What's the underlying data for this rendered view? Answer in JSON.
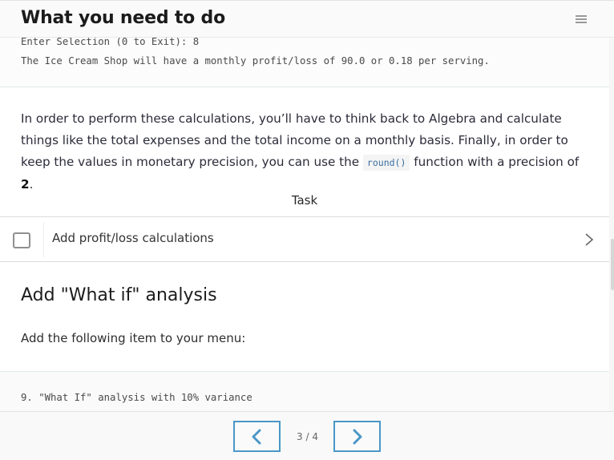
{
  "header": {
    "title": "What you need to do",
    "menu_icon": "hamburger-menu-icon"
  },
  "code_output": {
    "lines": [
      "Enter Selection (0 to Exit): 8",
      "The Ice Cream Shop will have a monthly profit/loss of 90.0 or 0.18 per serving."
    ]
  },
  "instructions": {
    "text_before_code": "In order to perform these calculations, you’ll have to think back to Algebra and calculate things like the total expenses and the total income on a monthly basis. Finally, in order to keep the values in monetary precision, you can use the ",
    "code": "round()",
    "text_after_code": " function with a precision of ",
    "precision": "2",
    "end": "."
  },
  "task": {
    "heading": "Task",
    "items": [
      {
        "label": "Add profit/loss calculations",
        "checked": false
      }
    ]
  },
  "section": {
    "title": "Add \"What if\" analysis",
    "subtitle": "Add the following item to your menu:",
    "code_line": "9. \"What If\" analysis with 10% variance"
  },
  "pagination": {
    "current": 3,
    "total": 4,
    "label": "3 / 4",
    "prev_icon": "chevron-left-icon",
    "next_icon": "chevron-right-icon"
  },
  "colors": {
    "accent": "#4a97c7",
    "code_text": "#3b6ea0"
  }
}
